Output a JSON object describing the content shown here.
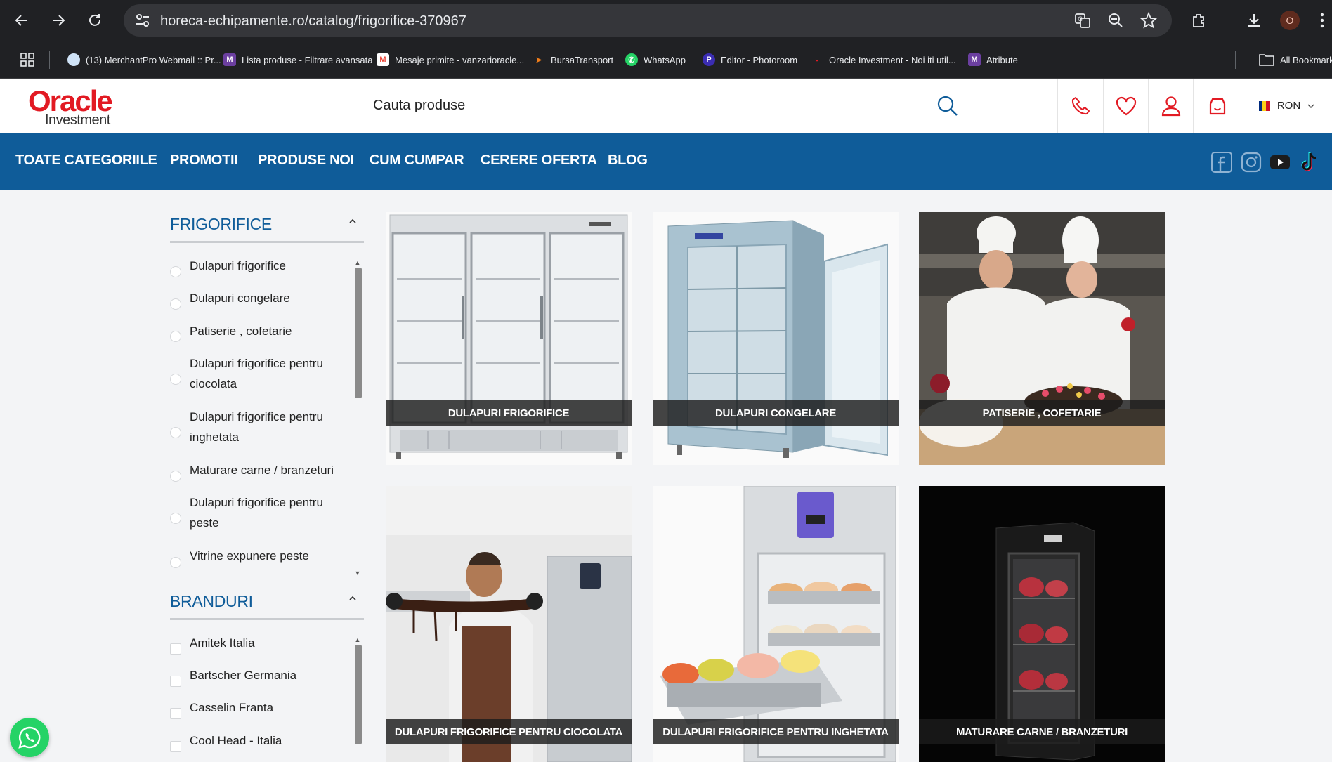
{
  "browser": {
    "url": "horeca-echipamente.ro/catalog/frigorifice-370967",
    "profile_initial": "O",
    "bookmarks": [
      {
        "label": "(13) MerchantPro Webmail :: Pr...",
        "icon": "merchantpro-icon",
        "color": "#5aa0e6"
      },
      {
        "label": "Lista produse - Filtrare avansata",
        "icon": "merchantpro-icon",
        "color": "#6b3fa0"
      },
      {
        "label": "Mesaje primite - vanzarioracle...",
        "icon": "gmail-icon",
        "color": "#ea4335"
      },
      {
        "label": "BursaTransport",
        "icon": "bursatransport-icon",
        "color": "#f07d1a"
      },
      {
        "label": "WhatsApp",
        "icon": "whatsapp-icon",
        "color": "#25d366"
      },
      {
        "label": "Editor - Photoroom",
        "icon": "photoroom-icon",
        "color": "#3b2db3"
      },
      {
        "label": "Oracle Investment - Noi iti util...",
        "icon": "oracle-icon",
        "color": "#e21a23"
      },
      {
        "label": "Atribute",
        "icon": "merchantpro-icon",
        "color": "#6b3fa0"
      }
    ],
    "all_bookmarks_label": "All Bookmarks"
  },
  "header": {
    "logo_line1": "Oracle",
    "logo_line2": "Investment",
    "search_placeholder": "Cauta produse",
    "currency": "RON",
    "flag_colors": [
      "#002b7f",
      "#fcd116",
      "#ce1126"
    ]
  },
  "nav": {
    "items": [
      "TOATE CATEGORIILE",
      "PROMOTII",
      "PRODUSE NOI",
      "CUM CUMPAR",
      "CERERE OFERTA",
      "BLOG"
    ],
    "accent_color": "#0f5c99"
  },
  "sidebar": {
    "categories_title": "FRIGORIFICE",
    "categories": [
      "Dulapuri frigorifice",
      "Dulapuri congelare",
      "Patiserie , cofetarie",
      "Dulapuri frigorifice pentru ciocolata",
      "Dulapuri frigorifice pentru inghetata",
      "Maturare carne / branzeturi",
      "Dulapuri frigorifice pentru peste",
      "Vitrine expunere peste"
    ],
    "brands_title": "BRANDURI",
    "brands": [
      "Amitek Italia",
      "Bartscher Germania",
      "Casselin Franta",
      "Cool Head  - Italia"
    ]
  },
  "cards": [
    {
      "title": "DULAPURI FRIGORIFICE"
    },
    {
      "title": "DULAPURI CONGELARE"
    },
    {
      "title": "PATISERIE , COFETARIE"
    },
    {
      "title": "DULAPURI FRIGORIFICE PENTRU CIOCOLATA"
    },
    {
      "title": "DULAPURI FRIGORIFICE PENTRU INGHETATA"
    },
    {
      "title": "MATURARE CARNE / BRANZETURI"
    }
  ]
}
